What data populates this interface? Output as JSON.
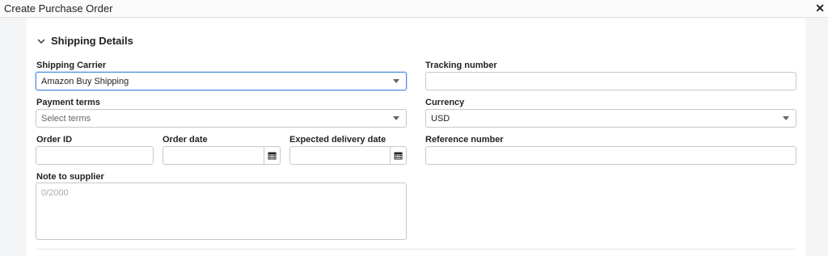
{
  "window": {
    "title": "Create Purchase Order",
    "close_icon": "close-icon"
  },
  "section": {
    "title": "Shipping Details",
    "expanded": true
  },
  "fields": {
    "shipping_carrier": {
      "label": "Shipping Carrier",
      "value": "Amazon Buy Shipping"
    },
    "tracking_number": {
      "label": "Tracking number",
      "value": ""
    },
    "payment_terms": {
      "label": "Payment terms",
      "placeholder": "Select terms"
    },
    "currency": {
      "label": "Currency",
      "value": "USD"
    },
    "order_id": {
      "label": "Order ID",
      "value": ""
    },
    "order_date": {
      "label": "Order date",
      "value": ""
    },
    "expected_delivery_date": {
      "label": "Expected delivery date",
      "value": ""
    },
    "reference_number": {
      "label": "Reference number",
      "value": ""
    },
    "note_to_supplier": {
      "label": "Note to supplier",
      "placeholder": "0/2000"
    }
  },
  "colors": {
    "focus_border": "#4a8fe0",
    "panel_bg": "#ffffff",
    "page_bg": "#f4f5f7"
  }
}
